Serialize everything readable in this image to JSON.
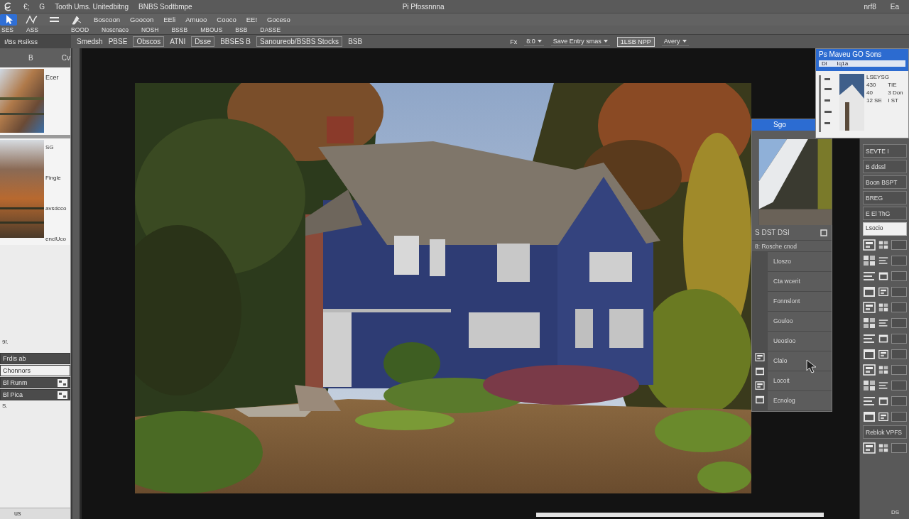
{
  "menu_bar": {
    "items": [
      "€;",
      "G",
      "Tooth Ums. Unitedbitng",
      "BNBS Sodtbmpe"
    ],
    "title": "Pi Pfossnnna",
    "right_items": [
      "nrf8",
      "Ea"
    ]
  },
  "tool_row": {
    "tools": [
      {
        "selected": true
      },
      {
        "selected": false
      },
      {
        "selected": false
      },
      {
        "selected": false
      }
    ],
    "labels": [
      "Boscoon",
      "Goocon",
      "EEli",
      "Amuoo",
      "Cooco",
      "EE!",
      "Goceso"
    ]
  },
  "info_row": {
    "items": [
      "SES",
      "ASS",
      "BOOD",
      "Noscnaco",
      "NOSH",
      "BSSB",
      "MBOUS",
      "BSB",
      "DASSE"
    ]
  },
  "options_bar": {
    "panel_label": "I/Bs Rsikss",
    "left_items": [
      {
        "kind": "text",
        "text": "Smedsh"
      },
      {
        "kind": "text",
        "text": "PBSE"
      },
      {
        "kind": "field",
        "text": "Obscos"
      },
      {
        "kind": "text",
        "text": "ATNI"
      },
      {
        "kind": "field",
        "text": "Dsse"
      },
      {
        "kind": "text",
        "text": "BBSES B"
      },
      {
        "kind": "field",
        "text": "Sanoureob/BSBS Stocks"
      },
      {
        "kind": "text",
        "text": "BSB"
      }
    ],
    "right_items": [
      {
        "kind": "text",
        "text": "Fx"
      },
      {
        "kind": "dropdown",
        "text": "8:0"
      },
      {
        "kind": "dropdown",
        "text": "Save Entry smas"
      },
      {
        "kind": "button",
        "text": "1LSB NPP"
      },
      {
        "kind": "dropdown",
        "text": "Avery"
      }
    ]
  },
  "left_panel": {
    "tabs": [
      "B",
      "Cv"
    ],
    "sections": [
      {
        "labels": [
          "Ecer"
        ]
      },
      {
        "labels": [
          "SG",
          "Fingle",
          "avsdcco",
          "enclUco"
        ]
      }
    ],
    "note": "9ſ.",
    "layers": [
      {
        "name": "Frdis ab",
        "kind": "plain",
        "selected": false
      },
      {
        "name": "Chonnors",
        "kind": "plain",
        "selected": true
      },
      {
        "name": "Bl Runm",
        "kind": "adjustment",
        "selected": false
      },
      {
        "name": "Bl Pica",
        "kind": "adjustment",
        "selected": false
      }
    ],
    "footnote": "S.",
    "status": "us"
  },
  "layers_panel": {
    "title": "Sgo",
    "header": "S DST DSI",
    "subheader": "8: Rosche cnod",
    "rows": [
      "Ltoszo",
      "Cta wcerit",
      "Fonnslont",
      "Gouloo",
      "Ueosloo",
      "Clalo",
      "Locoit",
      "Ecnolog"
    ]
  },
  "navigator": {
    "title": "Ps Maveu GO Sons",
    "menu": [
      "Dl",
      "Iq1a"
    ],
    "labels": [
      "LSEYSG",
      "430",
      "TIE",
      "40",
      "3 Don",
      "12 SE",
      "I ST"
    ]
  },
  "tools_panel": {
    "rows": [
      {
        "kind": "label",
        "text": "SEVTE I"
      },
      {
        "kind": "label",
        "text": "B ddssl"
      },
      {
        "kind": "label",
        "text": "Boon BSPT"
      },
      {
        "kind": "label",
        "text": "BREG"
      },
      {
        "kind": "label",
        "text": "E El ThG"
      },
      {
        "kind": "field",
        "text": "Lsocio"
      },
      {
        "kind": "icons"
      },
      {
        "kind": "icons"
      },
      {
        "kind": "icons"
      },
      {
        "kind": "icons"
      },
      {
        "kind": "icons"
      },
      {
        "kind": "icons"
      },
      {
        "kind": "icons"
      },
      {
        "kind": "icons"
      },
      {
        "kind": "icons"
      },
      {
        "kind": "icons"
      },
      {
        "kind": "icons"
      },
      {
        "kind": "icons"
      },
      {
        "kind": "label",
        "text": "Reblok VPFS"
      },
      {
        "kind": "icons"
      }
    ],
    "status": "DS"
  }
}
